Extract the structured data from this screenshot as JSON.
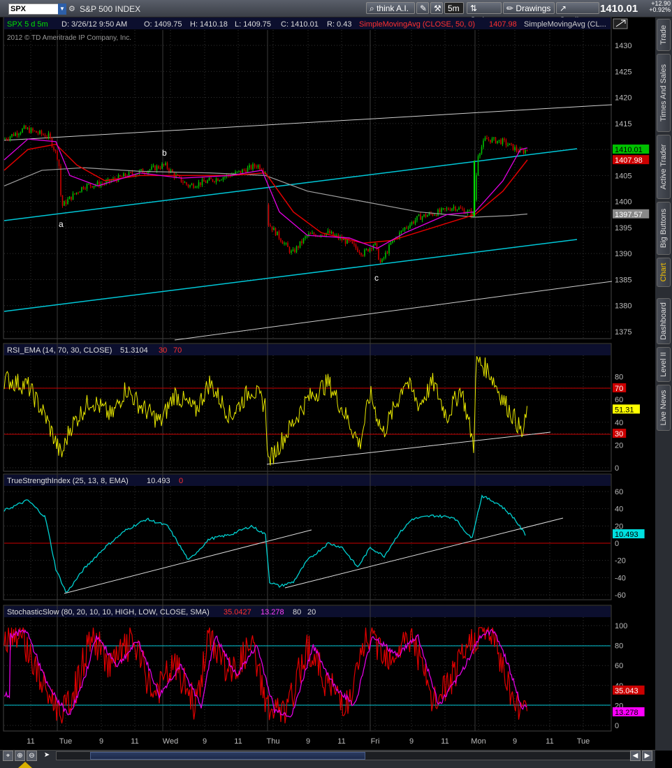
{
  "toolbar": {
    "symbol": "SPX",
    "symbol_description": "S&P 500 INDEX",
    "think_label": "think A.I.",
    "timeframe": "5m",
    "style_label": "Style",
    "drawings_label": "Drawings",
    "studies_label": "Studies",
    "last_price": "1410.01",
    "change": "+12.90",
    "change_pct": "+0.92%"
  },
  "price_panel": {
    "header": [
      "SPX 5 d 5m",
      "D: 3/26/12 9:50 AM",
      "O: 1409.75",
      "H: 1410.18",
      "L: 1409.75",
      "C: 1410.01",
      "R: 0.43"
    ],
    "sma_label": "SimpleMovingAvg (CLOSE, 50, 0)",
    "sma_value": "1407.98",
    "sma2_label": "SimpleMovingAvg (CL...",
    "copyright": "2012 © TD Ameritrade IP Company, Inc.",
    "y_ticks": [
      "1430",
      "1425",
      "1420",
      "1415",
      "1410",
      "1405",
      "1400",
      "1395",
      "1390",
      "1385",
      "1380",
      "1375"
    ],
    "badges": [
      {
        "text": "1410.01",
        "bg": "#00c000",
        "fg": "#000000"
      },
      {
        "text": "1407.98",
        "bg": "#cc0000",
        "fg": "#ffffff"
      },
      {
        "text": "1397.57",
        "bg": "#888888",
        "fg": "#ffffff"
      }
    ],
    "wave_labels": [
      "a",
      "b",
      "c"
    ]
  },
  "rsi_panel": {
    "header": "RSI_EMA (14, 70, 30, CLOSE)",
    "value": "51.3104",
    "level_lo": "30",
    "level_hi": "70",
    "y_ticks": [
      "80",
      "70",
      "60",
      "40",
      "30",
      "20",
      "0"
    ],
    "badges": [
      {
        "text": "70",
        "bg": "#cc0000",
        "fg": "#ffffff"
      },
      {
        "text": "51.31",
        "bg": "#ffff00",
        "fg": "#000000"
      },
      {
        "text": "30",
        "bg": "#cc0000",
        "fg": "#ffffff"
      }
    ]
  },
  "tsi_panel": {
    "header": "TrueStrengthIndex (25, 13, 8, EMA)",
    "value": "10.493",
    "zero": "0",
    "y_ticks": [
      "60",
      "40",
      "20",
      "0",
      "-20",
      "-40",
      "-60"
    ],
    "badges": [
      {
        "text": "10.493",
        "bg": "#00e0e0",
        "fg": "#000000"
      }
    ]
  },
  "stoch_panel": {
    "header": "StochasticSlow (80, 20, 10, 10, HIGH, LOW, CLOSE, SMA)",
    "value_k": "35.0427",
    "value_d": "13.278",
    "level_hi": "80",
    "level_lo": "20",
    "y_ticks": [
      "100",
      "80",
      "60",
      "40",
      "20",
      "0"
    ],
    "badges": [
      {
        "text": "35.043",
        "bg": "#cc0000",
        "fg": "#ffffff"
      },
      {
        "text": "13.278",
        "bg": "#ff00ff",
        "fg": "#000000"
      }
    ]
  },
  "x_axis": [
    "11",
    "Tue",
    "9",
    "11",
    "Wed",
    "9",
    "11",
    "Thu",
    "9",
    "11",
    "Fri",
    "9",
    "11",
    "Mon",
    "9",
    "11",
    "Tue"
  ],
  "side_tabs": [
    "Trade",
    "Times And Sales",
    "Active Trader",
    "Big Buttons",
    "Chart",
    "Dashboard",
    "Level II",
    "Live News"
  ],
  "colors": {
    "price_up": "#00c000",
    "price_down": "#cc0000",
    "rsi": "#e8e800",
    "tsi": "#00d0d0",
    "stoch_k": "#e00000",
    "stoch_d": "#e000e0",
    "channel": "#00c8d8",
    "grid": "#3a3a3a"
  }
}
